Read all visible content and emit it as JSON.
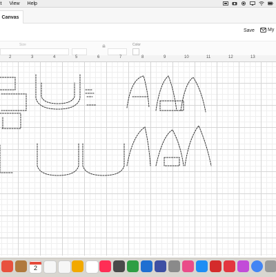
{
  "menubar": {
    "items": [
      "it",
      "View",
      "Help"
    ],
    "status_icons": [
      "screen-mirror-icon",
      "camera-icon",
      "record-icon",
      "airplay-icon",
      "wifi-icon",
      "battery-icon"
    ]
  },
  "tabs": [
    {
      "label": "Canvas",
      "active": true
    }
  ],
  "header": {
    "save_label": "Save",
    "account_label": "My",
    "account_icon": "envelope-icon"
  },
  "toolbar": {
    "size_label": "Size",
    "color_label": "Color",
    "fields": [
      "w-field",
      "h-field",
      "x-field"
    ],
    "lock_icon": "lock-icon"
  },
  "ruler": {
    "labels": [
      "2",
      "3",
      "4",
      "5",
      "6",
      "7",
      "8",
      "9",
      "10",
      "11",
      "12",
      "13"
    ]
  },
  "dock": {
    "calendar_day": "2",
    "items": [
      {
        "name": "dock-app-1-icon",
        "color": "#e8513e"
      },
      {
        "name": "dock-notes-icon",
        "color": "#b0793d"
      },
      {
        "name": "dock-calendar-icon",
        "color": "#ffffff"
      },
      {
        "name": "dock-reminders-icon",
        "color": "#f6f6f6"
      },
      {
        "name": "dock-photos-icon",
        "color": "#f2a900"
      },
      {
        "name": "dock-music-app-icon",
        "color": "#ff2d55"
      },
      {
        "name": "dock-ios-app-icon",
        "color": "#4a4a4a"
      },
      {
        "name": "dock-numbers-icon",
        "color": "#2f9e44"
      },
      {
        "name": "dock-keynote-icon",
        "color": "#1f6fd1"
      },
      {
        "name": "dock-app-blue-icon",
        "color": "#3d4fa3"
      },
      {
        "name": "dock-app-gray-icon",
        "color": "#8a8a8a"
      },
      {
        "name": "dock-itunes-icon",
        "color": "#ea4c89"
      },
      {
        "name": "dock-app-store-icon",
        "color": "#1e8ef4"
      },
      {
        "name": "dock-acrobat-icon",
        "color": "#d42b2b"
      },
      {
        "name": "dock-creative-cloud-icon",
        "color": "#e3363f"
      },
      {
        "name": "dock-app-pink-icon",
        "color": "#c24cd8"
      },
      {
        "name": "dock-chrome-icon",
        "color": "#4285f4"
      },
      {
        "name": "dock-app-last-icon",
        "color": "#9a9a9a"
      }
    ]
  }
}
